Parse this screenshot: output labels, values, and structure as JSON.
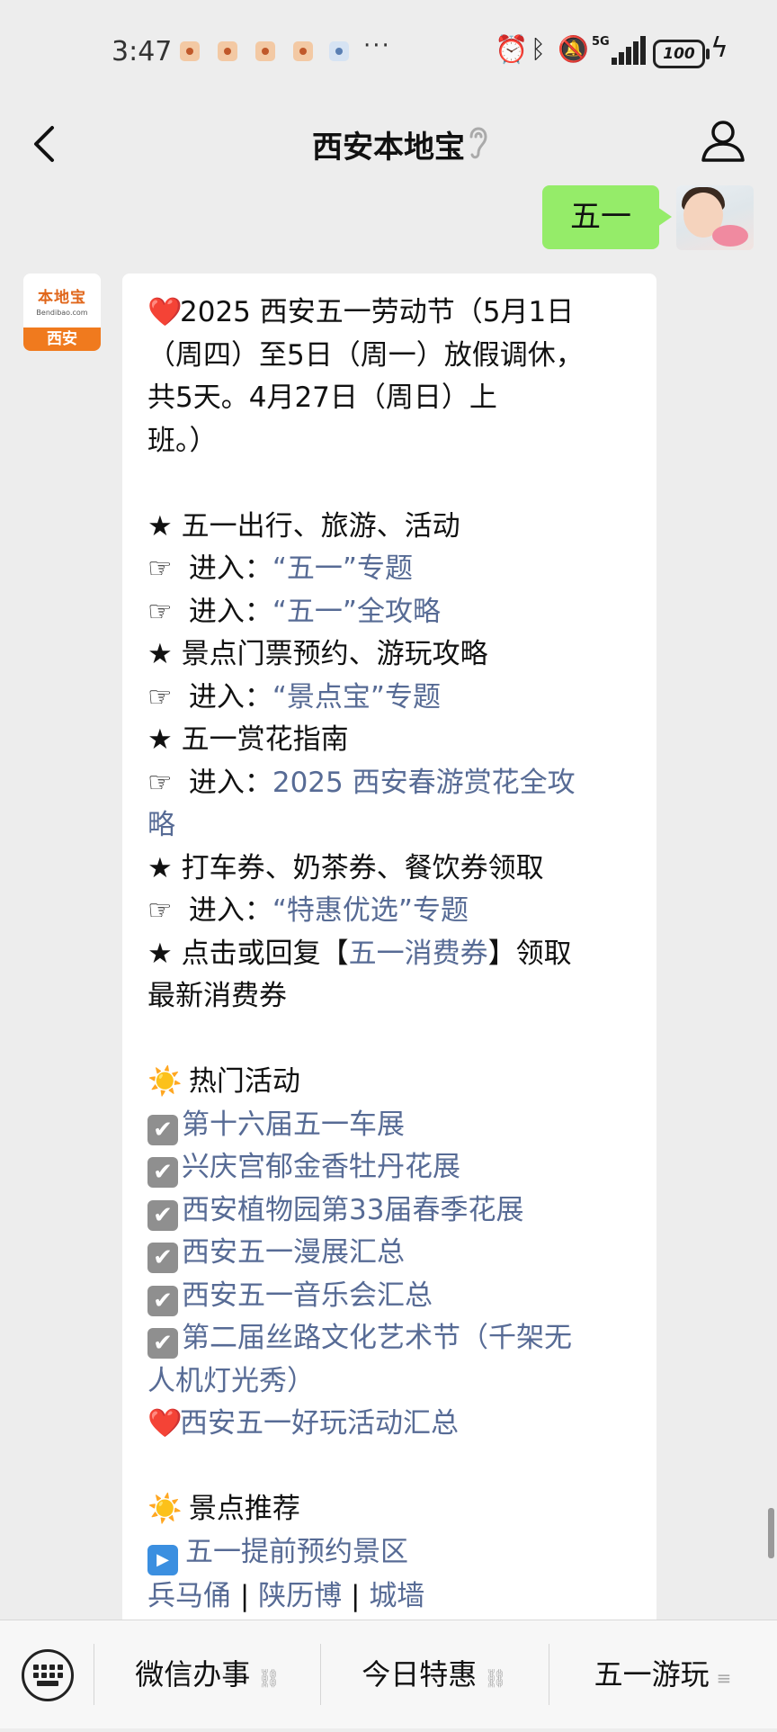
{
  "status": {
    "time": "3:47",
    "more": "···",
    "network": "5G",
    "battery": "100"
  },
  "header": {
    "title": "西安本地宝"
  },
  "chat": {
    "user_message": "五一",
    "bot_avatar": {
      "logo_text": "本地宝",
      "site": "Bendibao.com",
      "city": "西安"
    },
    "bot_lines": [
      {
        "segs": [
          {
            "g": "❤️",
            "c": "heart"
          },
          {
            "t": "2025 西安五一劳动节（5月1日"
          }
        ]
      },
      {
        "segs": [
          {
            "t": "（周四）至5日（周一）放假调休，"
          }
        ]
      },
      {
        "segs": [
          {
            "t": "共5天。4月27日（周日）上"
          }
        ]
      },
      {
        "segs": [
          {
            "t": "班。）"
          }
        ]
      },
      {
        "segs": []
      },
      {
        "segs": [
          {
            "t": "★ 五一出行、旅游、活动"
          }
        ]
      },
      {
        "segs": [
          {
            "g": "☞",
            "c": ""
          },
          {
            "t": " 进入："
          },
          {
            "t": "“五一”专题",
            "l": true
          }
        ]
      },
      {
        "segs": [
          {
            "g": "☞",
            "c": ""
          },
          {
            "t": " 进入："
          },
          {
            "t": "“五一”全攻略",
            "l": true
          }
        ]
      },
      {
        "segs": [
          {
            "t": "★ 景点门票预约、游玩攻略"
          }
        ]
      },
      {
        "segs": [
          {
            "g": "☞",
            "c": ""
          },
          {
            "t": " 进入："
          },
          {
            "t": "“景点宝”专题",
            "l": true
          }
        ]
      },
      {
        "segs": [
          {
            "t": "★ 五一赏花指南"
          }
        ]
      },
      {
        "segs": [
          {
            "g": "☞",
            "c": ""
          },
          {
            "t": " 进入："
          },
          {
            "t": "2025 西安春游赏花全攻",
            "l": true
          }
        ]
      },
      {
        "segs": [
          {
            "t": "略",
            "l": true
          }
        ]
      },
      {
        "segs": [
          {
            "t": "★ 打车券、奶茶券、餐饮券领取"
          }
        ]
      },
      {
        "segs": [
          {
            "g": "☞",
            "c": ""
          },
          {
            "t": " 进入："
          },
          {
            "t": "“特惠优选”专题",
            "l": true
          }
        ]
      },
      {
        "segs": [
          {
            "t": "★ 点击或回复【"
          },
          {
            "t": "五一消费券",
            "l": true
          },
          {
            "t": "】领取"
          }
        ]
      },
      {
        "segs": [
          {
            "t": "最新消费券"
          }
        ]
      },
      {
        "segs": []
      },
      {
        "segs": [
          {
            "g": "☀️",
            "c": "sun"
          },
          {
            "t": " 热门活动"
          }
        ]
      },
      {
        "segs": [
          {
            "k": "check"
          },
          {
            "t": "第十六届五一车展",
            "l": true
          }
        ]
      },
      {
        "segs": [
          {
            "k": "check"
          },
          {
            "t": "兴庆宫郁金香牡丹花展",
            "l": true
          }
        ]
      },
      {
        "segs": [
          {
            "k": "check"
          },
          {
            "t": "西安植物园第33届春季花展",
            "l": true
          }
        ]
      },
      {
        "segs": [
          {
            "k": "check"
          },
          {
            "t": "西安五一漫展汇总",
            "l": true
          }
        ]
      },
      {
        "segs": [
          {
            "k": "check"
          },
          {
            "t": "西安五一音乐会汇总",
            "l": true
          }
        ]
      },
      {
        "segs": [
          {
            "k": "check"
          },
          {
            "t": "第二届丝路文化艺术节（千架无",
            "l": true
          }
        ]
      },
      {
        "segs": [
          {
            "t": "人机灯光秀）",
            "l": true
          }
        ]
      },
      {
        "segs": [
          {
            "g": "❤️",
            "c": "heart"
          },
          {
            "t": "西安五一好玩活动汇总",
            "l": true
          }
        ]
      },
      {
        "segs": []
      },
      {
        "segs": [
          {
            "g": "☀️",
            "c": "sun"
          },
          {
            "t": " 景点推荐"
          }
        ]
      },
      {
        "segs": [
          {
            "k": "play"
          },
          {
            "t": "五一提前预约景区",
            "l": true
          }
        ]
      },
      {
        "segs": [
          {
            "t": "兵马俑",
            "l": true
          },
          {
            "t": " | "
          },
          {
            "t": "陕历博",
            "l": true
          },
          {
            "t": " | "
          },
          {
            "t": "城墙",
            "l": true
          }
        ]
      }
    ]
  },
  "menu": {
    "items": [
      "微信办事",
      "今日特惠",
      "五一游玩"
    ]
  },
  "colors": {
    "bubble_user": "#95ec69",
    "link": "#576b95",
    "background": "#ededed"
  }
}
